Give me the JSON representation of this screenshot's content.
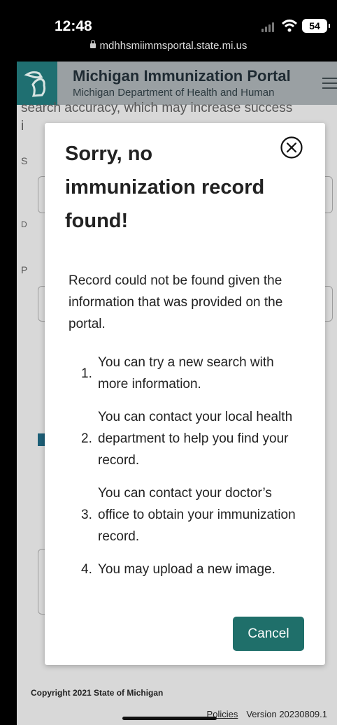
{
  "status_bar": {
    "time": "12:48",
    "battery": "54",
    "url": "mdhhsmiimmsportal.state.mi.us"
  },
  "header": {
    "title": "Michigan Immunization Portal",
    "subtitle": "Michigan Department of Health and Human"
  },
  "background": {
    "visible_text": "search accuracy, which may increase success"
  },
  "modal": {
    "title": "Sorry, no immunization record found!",
    "message": "Record could not be found given the information that was provided on the portal.",
    "steps": [
      {
        "number": "1.",
        "text": "You can try a new search with more information."
      },
      {
        "number": "2.",
        "text": "You can contact your local health department to help you find your record."
      },
      {
        "number": "3.",
        "text": "You can contact your doctor’s office to obtain your immunization record."
      },
      {
        "number": "4.",
        "text": "You may upload a new image."
      }
    ],
    "cancel_label": "Cancel"
  },
  "footer": {
    "copyright": "Copyright 2021 State of Michigan",
    "policies_label": "Policies",
    "version": "Version 20230809.1"
  },
  "colors": {
    "primary": "#1f6f6a",
    "header_bg": "#9aa0a3",
    "overlay": "#d8d8d8"
  },
  "icons": {
    "close": "circle-x-icon",
    "menu": "hamburger-menu-icon",
    "lock": "lock-icon"
  }
}
